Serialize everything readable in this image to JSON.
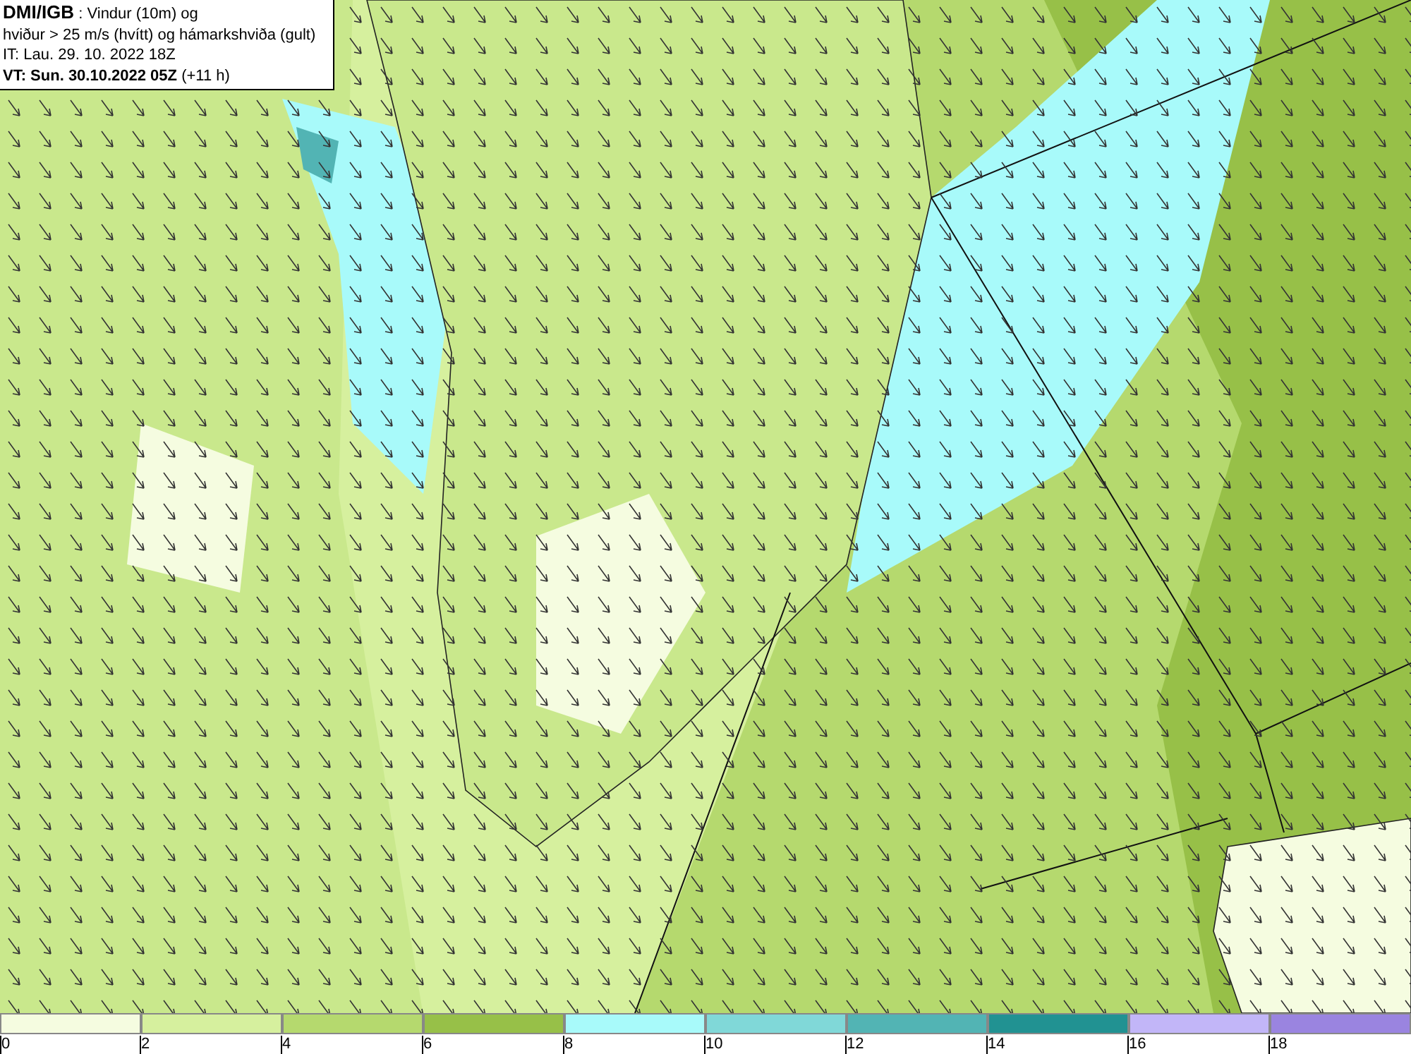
{
  "title_box": {
    "lines": [
      "**DMI/IGB** : Vindur (10m) og",
      "hviður > 25 m/s (hvítt) og hámarkshviða (gult)",
      "IT: Lau. 29. 10. 2022 18Z",
      "**VT: Sun. 30.10.2022 05Z** (+11 h)"
    ]
  },
  "legend": {
    "bins": [
      {
        "color": "#f5fce0",
        "tick": "0"
      },
      {
        "color": "#d6f09e",
        "tick": "2"
      },
      {
        "color": "#b5d96e",
        "tick": "4"
      },
      {
        "color": "#97c048",
        "tick": "6"
      },
      {
        "color": "#a8fafa",
        "tick": "8"
      },
      {
        "color": "#80d8d8",
        "tick": "10"
      },
      {
        "color": "#52b4b4",
        "tick": "12"
      },
      {
        "color": "#219292",
        "tick": "14"
      },
      {
        "color": "#c2b6f8",
        "tick": "16"
      },
      {
        "color": "#9a84e0",
        "tick": "18"
      }
    ]
  }
}
